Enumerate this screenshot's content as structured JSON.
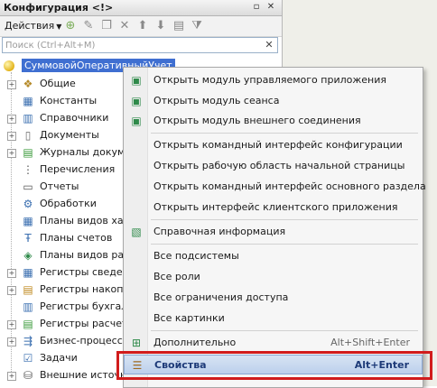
{
  "panel": {
    "title": "Конфигурация <!>",
    "actions_label": "Действия",
    "search_placeholder": "Поиск (Ctrl+Alt+M)"
  },
  "tree": {
    "root": "СуммовойОперативныйУчет",
    "items": [
      {
        "label": "Общие",
        "icon": "folder-icon",
        "expandable": true
      },
      {
        "label": "Константы",
        "icon": "constants-icon",
        "expandable": false
      },
      {
        "label": "Справочники",
        "icon": "catalog-icon",
        "expandable": true
      },
      {
        "label": "Документы",
        "icon": "document-icon",
        "expandable": true
      },
      {
        "label": "Журналы докумен",
        "icon": "journal-icon",
        "expandable": true
      },
      {
        "label": "Перечисления",
        "icon": "enum-icon",
        "expandable": false
      },
      {
        "label": "Отчеты",
        "icon": "report-icon",
        "expandable": false
      },
      {
        "label": "Обработки",
        "icon": "processing-icon",
        "expandable": false
      },
      {
        "label": "Планы видов хара",
        "icon": "chart-types-icon",
        "expandable": false
      },
      {
        "label": "Планы счетов",
        "icon": "chart-accounts-icon",
        "expandable": false
      },
      {
        "label": "Планы видов расче",
        "icon": "calc-types-icon",
        "expandable": false
      },
      {
        "label": "Регистры сведени",
        "icon": "info-register-icon",
        "expandable": true
      },
      {
        "label": "Регистры накопле",
        "icon": "accum-register-icon",
        "expandable": true
      },
      {
        "label": "Регистры бухгалт",
        "icon": "account-register-icon",
        "expandable": false
      },
      {
        "label": "Регистры расчета",
        "icon": "calc-register-icon",
        "expandable": true
      },
      {
        "label": "Бизнес-процессы",
        "icon": "business-process-icon",
        "expandable": true
      },
      {
        "label": "Задачи",
        "icon": "task-icon",
        "expandable": false
      },
      {
        "label": "Внешние источни",
        "icon": "external-source-icon",
        "expandable": true
      }
    ]
  },
  "menu": {
    "items": [
      {
        "label": "Открыть модуль управляемого приложения",
        "icon": "module-icon"
      },
      {
        "label": "Открыть модуль сеанса",
        "icon": "module-icon"
      },
      {
        "label": "Открыть модуль внешнего соединения",
        "icon": "module-icon"
      },
      {
        "label": "Открыть командный интерфейс конфигурации",
        "icon": ""
      },
      {
        "label": "Открыть рабочую область начальной страницы",
        "icon": ""
      },
      {
        "label": "Открыть командный интерфейс основного раздела",
        "icon": ""
      },
      {
        "label": "Открыть интерфейс клиентского приложения",
        "icon": ""
      },
      {
        "label": "Справочная информация",
        "icon": "help-icon"
      },
      {
        "label": "Все подсистемы",
        "icon": ""
      },
      {
        "label": "Все роли",
        "icon": ""
      },
      {
        "label": "Все ограничения доступа",
        "icon": ""
      },
      {
        "label": "Все картинки",
        "icon": ""
      },
      {
        "label": "Дополнительно",
        "icon": "extra-icon",
        "shortcut": "Alt+Shift+Enter"
      },
      {
        "label": "Свойства",
        "icon": "properties-icon",
        "shortcut": "Alt+Enter"
      }
    ]
  },
  "colors": {
    "selection": "#3f6fd1",
    "highlight_frame": "#d11c1c"
  }
}
